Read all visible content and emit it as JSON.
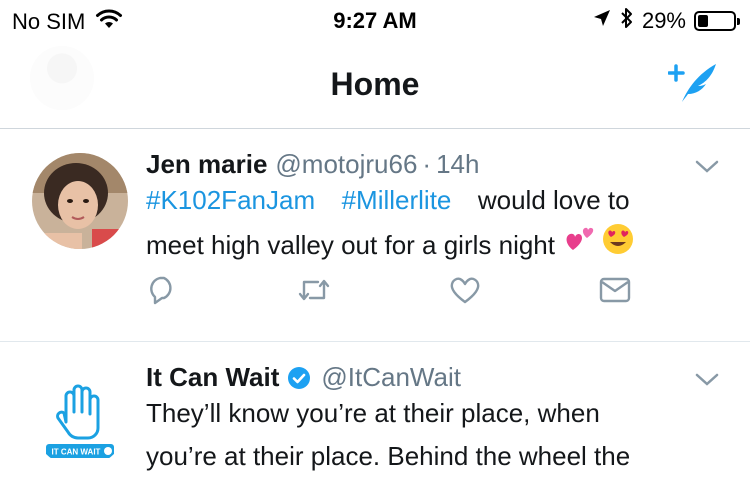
{
  "status_bar": {
    "carrier": "No SIM",
    "time": "9:27 AM",
    "battery_percent": "29%",
    "battery_level": 0.29,
    "icons": [
      "wifi-icon",
      "location-arrow-icon",
      "bluetooth-icon",
      "battery-icon"
    ]
  },
  "nav": {
    "title": "Home",
    "compose_icon": "compose-tweet-icon",
    "accent_color": "#1da1f2"
  },
  "tweets": [
    {
      "name": "Jen marie",
      "handle": "@motojru66",
      "separator": "·",
      "ago": "14h",
      "hashtags": [
        "#K102FanJam",
        "#Millerlite"
      ],
      "text_line1": "would love to",
      "text_line2": "meet high valley out for a girls night",
      "emojis": [
        "two-hearts-emoji",
        "heart-eyes-emoji"
      ],
      "actions": [
        "reply-icon",
        "retweet-icon",
        "like-icon",
        "direct-message-icon"
      ]
    },
    {
      "name": "It Can Wait",
      "verified": true,
      "handle": "@ItCanWait",
      "avatar_text": "IT CAN WAIT",
      "text_line1": "They’ll know you’re at their place, when",
      "text_line2": "you’re at their place. Behind the wheel the"
    }
  ],
  "colors": {
    "link": "#1b95e0",
    "secondary_text": "#657786",
    "icon_gray": "#8899a6"
  }
}
